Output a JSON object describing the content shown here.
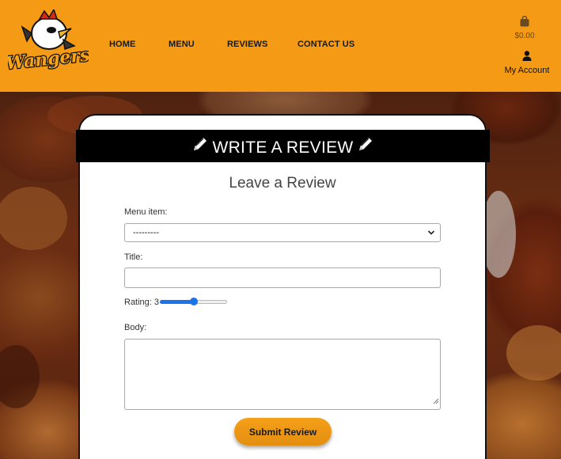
{
  "brand": {
    "logo_text": "Wangers"
  },
  "nav": {
    "home": "HOME",
    "menu": "MENU",
    "reviews": "REVIEWS",
    "contact": "CONTACT US"
  },
  "cart": {
    "icon": "shopping-bag-icon",
    "amount": "$0.00"
  },
  "account": {
    "icon": "user-icon",
    "label": "My Account"
  },
  "review_form": {
    "banner": "WRITE A REVIEW",
    "heading": "Leave a Review",
    "menu_item_label": "Menu item:",
    "menu_item_value": "---------",
    "title_label": "Title:",
    "title_value": "",
    "rating_label": "Rating: 3",
    "rating": {
      "value": 3,
      "min": 1,
      "max": 5
    },
    "body_label": "Body:",
    "body_value": "",
    "submit_label": "Submit Review"
  },
  "colors": {
    "header_bg": "#f49a14",
    "banner_bg": "#000000",
    "accent_blue": "#1a73e8",
    "button_bg": "#f5a019"
  }
}
